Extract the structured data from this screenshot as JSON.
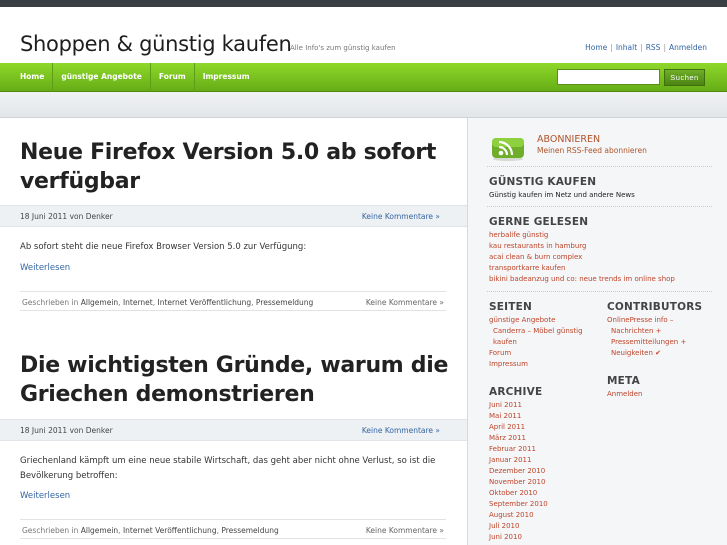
{
  "header": {
    "site_title": "Shoppen & günstig kaufen",
    "tagline": "Alle Info's zum günstig kaufen",
    "links": [
      "Home",
      "Inhalt",
      "RSS",
      "Anmelden"
    ]
  },
  "nav": {
    "items": [
      "Home",
      "günstige Angebote",
      "Forum",
      "Impressum"
    ],
    "search_placeholder": "",
    "search_button": "Suchen"
  },
  "posts": [
    {
      "title_lines": [
        "Neue Firefox Version 5.0 ab sofort",
        "verfügbar"
      ],
      "date_author": "18 Juni 2011 von Denker",
      "comments": "Keine Kommentare »",
      "excerpt": "Ab sofort steht die neue Firefox Browser Version 5.0 zur Verfügung:",
      "read_more": "Weiterlesen",
      "written_in": "Geschrieben in",
      "categories": [
        "Allgemein",
        "Internet",
        "Internet Veröffentlichung",
        "Pressemeldung"
      ],
      "footer_comments": "Keine Kommentare »"
    },
    {
      "title_lines": [
        "Die wichtigsten Gründe, warum die",
        "Griechen demonstrieren"
      ],
      "date_author": "18 Juni 2011 von Denker",
      "comments": "Keine Kommentare »",
      "excerpt_lines": [
        "Griechenland kämpft um eine neue stabile Wirtschaft, das geht aber nicht ohne Verlust, so ist die",
        "Bevölkerung betroffen:"
      ],
      "read_more": "Weiterlesen",
      "written_in": "Geschrieben in",
      "categories": [
        "Allgemein",
        "Internet Veröffentlichung",
        "Pressemeldung"
      ],
      "footer_comments": "Keine Kommentare »"
    }
  ],
  "sidebar": {
    "rss_title": "ABONNIEREN",
    "rss_subtitle": "Meinen RSS-Feed abonnieren",
    "rss_color": "#b0542a",
    "guenstig": {
      "title": "GÜNSTIG KAUFEN",
      "text": "Günstig kaufen im Netz und andere News"
    },
    "gerne": {
      "title": "GERNE GELESEN",
      "items": [
        "herbalife günstig",
        "kau restaurants in hamburg",
        "acai clean & burn complex",
        "transportkarre kaufen",
        "bikini badeanzug und co: neue trends im online shop"
      ]
    },
    "seiten": {
      "title": "SEITEN",
      "items": [
        "günstige Angebote",
        "Canderra – Möbel günstig",
        "kaufen",
        "Forum",
        "Impressum"
      ]
    },
    "contributors": {
      "title": "CONTRIBUTORS",
      "items": [
        "OnlinePresse info –",
        "Nachrichten +",
        "Pressemitteilungen +",
        "Neuigkeiten ✔"
      ]
    },
    "archive": {
      "title": "ARCHIVE",
      "items": [
        "Juni 2011",
        "Mai 2011",
        "April 2011",
        "März 2011",
        "Februar 2011",
        "Januar 2011",
        "Dezember 2010",
        "November 2010",
        "Oktober 2010",
        "September 2010",
        "August 2010",
        "Juli 2010",
        "Juni 2010"
      ]
    },
    "meta": {
      "title": "META",
      "items": [
        "Anmelden"
      ]
    }
  },
  "colors": {
    "accent_green": "#7cc51f",
    "link_blue": "#3465a4",
    "sidebar_link": "#c0452a"
  }
}
